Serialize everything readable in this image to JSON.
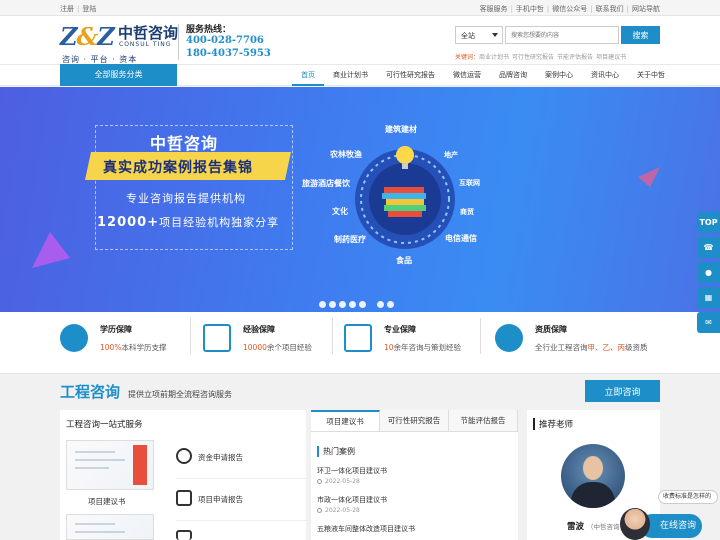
{
  "topbar": {
    "left": [
      "注册",
      "登陆"
    ],
    "right": [
      "客服服务",
      "手机中哲",
      "微信公众号",
      "联系我们",
      "网站导航"
    ]
  },
  "logo": {
    "mark_left": "Z",
    "mark_amp": "&",
    "mark_right": "Z",
    "name_cn": "中哲咨询",
    "name_en": "CONSUL TING",
    "tagline": "咨询 · 平台 · 资本"
  },
  "hotline": {
    "label": "服务热线：",
    "phone1": "400-028-7706",
    "phone2": "180-4037-5953"
  },
  "search": {
    "scope": "全站",
    "placeholder": "搜索您想要的内容",
    "button": "搜索",
    "keywords_label": "关键词：",
    "keywords": [
      "商业计划书",
      "可行性研究报告",
      "节能评估报告",
      "项目建议书"
    ]
  },
  "nav": {
    "all_services": "全部服务分类",
    "items": [
      "首页",
      "商业计划书",
      "可行性研究报告",
      "微信运营",
      "品牌咨询",
      "案例中心",
      "资讯中心",
      "关于中哲"
    ]
  },
  "banner": {
    "title": "中哲咨询",
    "ribbon": "真实成功案例报告集锦",
    "sub1": "专业咨询报告提供机构",
    "sub2_num": "12000+",
    "sub2_rest": "项目经验机构独家分享",
    "industries": [
      "建筑建材",
      "地产",
      "互联网",
      "商贸",
      "电信通信",
      "食品",
      "制药医疗",
      "文化",
      "旅游酒店餐饮",
      "农林牧渔"
    ]
  },
  "features": [
    {
      "title": "学历保障",
      "hl": "100%",
      "rest": "本科学历支撑"
    },
    {
      "title": "经验保障",
      "hl": "10000",
      "rest": "余个项目经验"
    },
    {
      "title": "专业保障",
      "hl": "10",
      "rest": "余年咨询与策划经验"
    },
    {
      "title": "资质保障",
      "desc_a": "全行业工程咨询",
      "hl1": "甲",
      "sep1": "、",
      "hl2": "乙",
      "sep2": "、",
      "hl3": "丙",
      "desc_b": "级资质"
    }
  ],
  "section": {
    "title": "工程咨询",
    "subtitle": "提供立项前期全流程咨询服务",
    "button": "立即咨询"
  },
  "one_stop": {
    "title": "工程咨询一站式服务",
    "thumb_label": "项目建议书",
    "services": [
      "资金申请报告",
      "项目申请报告"
    ]
  },
  "tabs": [
    "项目建议书",
    "可行性研究报告",
    "节能评估报告"
  ],
  "cases": {
    "heading": "热门案例",
    "items": [
      {
        "name": "环卫一体化项目建议书",
        "date": "2022-05-28"
      },
      {
        "name": "市政一体化项目建议书",
        "date": "2022-05-28"
      },
      {
        "name": "五粮液车间整体改造项目建议书",
        "date": ""
      }
    ]
  },
  "teacher": {
    "title": "推荐老师",
    "name": "雷波",
    "org": "（中哲咨询合伙"
  },
  "side_rail": [
    "TOP"
  ],
  "chat": {
    "bubble": "收费标准是怎样的",
    "button": "在线咨询"
  }
}
